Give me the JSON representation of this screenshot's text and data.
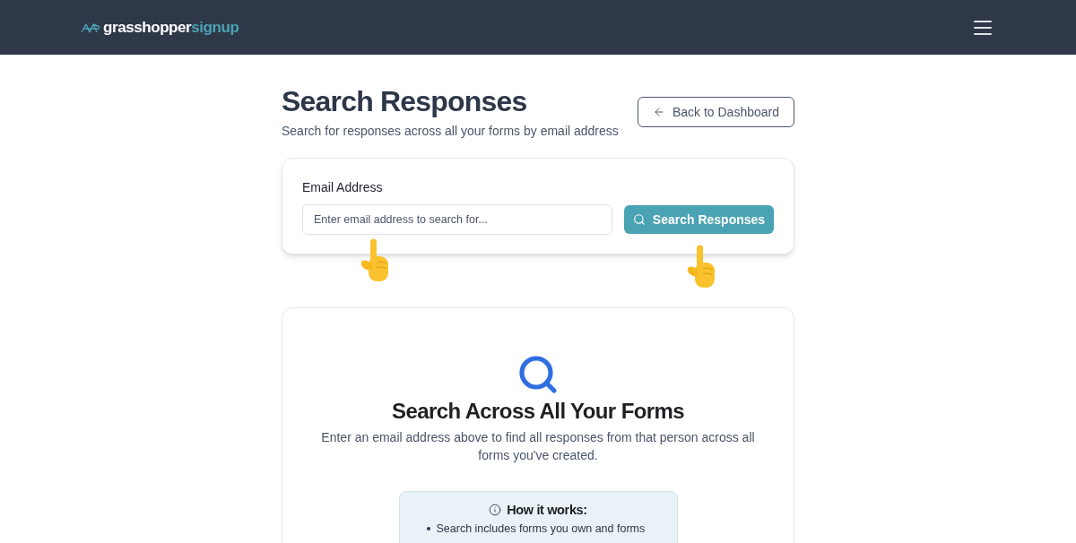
{
  "header": {
    "logo": {
      "primary": "grasshopper",
      "secondary": "signup"
    }
  },
  "page": {
    "title": "Search Responses",
    "subtitle": "Search for responses across all your forms by email address",
    "back_button": {
      "label": "Back to Dashboard"
    }
  },
  "search_card": {
    "label": "Email Address",
    "email_field": {
      "placeholder": "Enter email address to search for..."
    },
    "search_button": {
      "label": "Search Responses"
    }
  },
  "empty_state": {
    "title": "Search Across All Your Forms",
    "description": "Enter an email address above to find all responses from that person across all forms you've created.",
    "how_it_works": {
      "title": "How it works:",
      "items": [
        "Search includes forms you own and forms"
      ]
    }
  }
}
